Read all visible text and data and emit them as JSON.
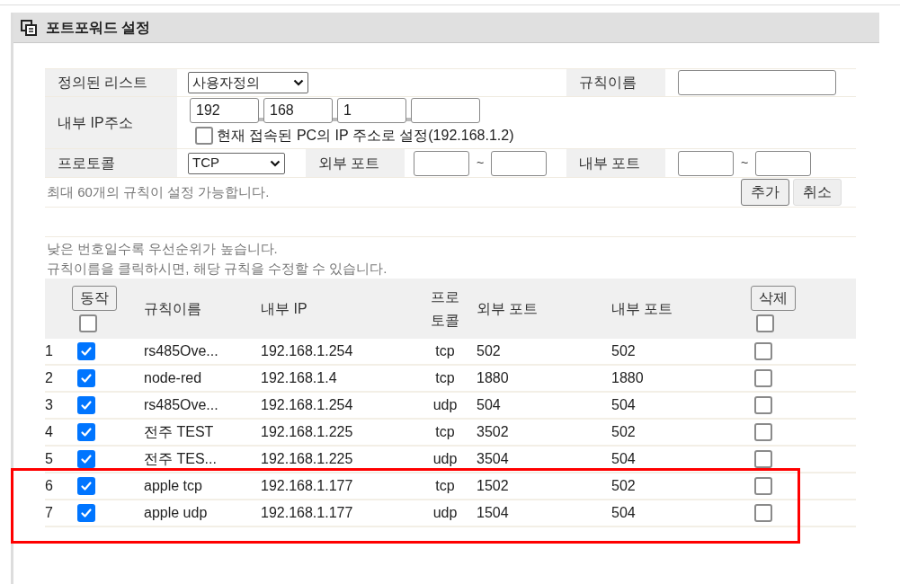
{
  "panel": {
    "title": "포트포워드 설정"
  },
  "form": {
    "preset_label": "정의된 리스트",
    "preset_value": "사용자정의",
    "rule_name_label": "규칙이름",
    "ip_label": "내부 IP주소",
    "ip_octets": [
      "192",
      "168",
      "1"
    ],
    "use_current_pc": {
      "label": "현재 접속된 PC의 IP 주소로 설정(192.168.1.2)",
      "checked": false
    },
    "protocol_label": "프로토콜",
    "protocol_value": "TCP",
    "external_port_label": "외부 포트",
    "internal_port_label": "내부 포트",
    "range_separator": "~",
    "limit_note": "최대 60개의 규칙이 설정 가능합니다.",
    "add_button": "추가",
    "cancel_button": "취소"
  },
  "notes": [
    "낮은 번호일수록 우선순위가 높습니다.",
    "규칙이름을 클릭하시면, 해당 규칙을 수정할 수 있습니다."
  ],
  "table": {
    "action_button": "동작",
    "action_all_checked": false,
    "columns": [
      "규칙이름",
      "내부 IP",
      "프로\n토콜",
      "외부 포트",
      "내부 포트"
    ],
    "delete_button": "삭제",
    "delete_all_checked": false,
    "rows": [
      {
        "no": "1",
        "enabled": true,
        "name": "rs485Ove...",
        "ip": "192.168.1.254",
        "protocol": "tcp",
        "external_port": "502",
        "internal_port": "502",
        "delete": false,
        "highlighted": false
      },
      {
        "no": "2",
        "enabled": true,
        "name": "node-red",
        "ip": "192.168.1.4",
        "protocol": "tcp",
        "external_port": "1880",
        "internal_port": "1880",
        "delete": false,
        "highlighted": false
      },
      {
        "no": "3",
        "enabled": true,
        "name": "rs485Ove...",
        "ip": "192.168.1.254",
        "protocol": "udp",
        "external_port": "504",
        "internal_port": "504",
        "delete": false,
        "highlighted": false
      },
      {
        "no": "4",
        "enabled": true,
        "name": "전주 TEST",
        "ip": "192.168.1.225",
        "protocol": "tcp",
        "external_port": "3502",
        "internal_port": "502",
        "delete": false,
        "highlighted": false
      },
      {
        "no": "5",
        "enabled": true,
        "name": "전주 TES...",
        "ip": "192.168.1.225",
        "protocol": "udp",
        "external_port": "3504",
        "internal_port": "504",
        "delete": false,
        "highlighted": false
      },
      {
        "no": "6",
        "enabled": true,
        "name": "apple tcp",
        "ip": "192.168.1.177",
        "protocol": "tcp",
        "external_port": "1502",
        "internal_port": "502",
        "delete": false,
        "highlighted": true
      },
      {
        "no": "7",
        "enabled": true,
        "name": "apple udp",
        "ip": "192.168.1.177",
        "protocol": "udp",
        "external_port": "1504",
        "internal_port": "504",
        "delete": false,
        "highlighted": true
      }
    ]
  }
}
